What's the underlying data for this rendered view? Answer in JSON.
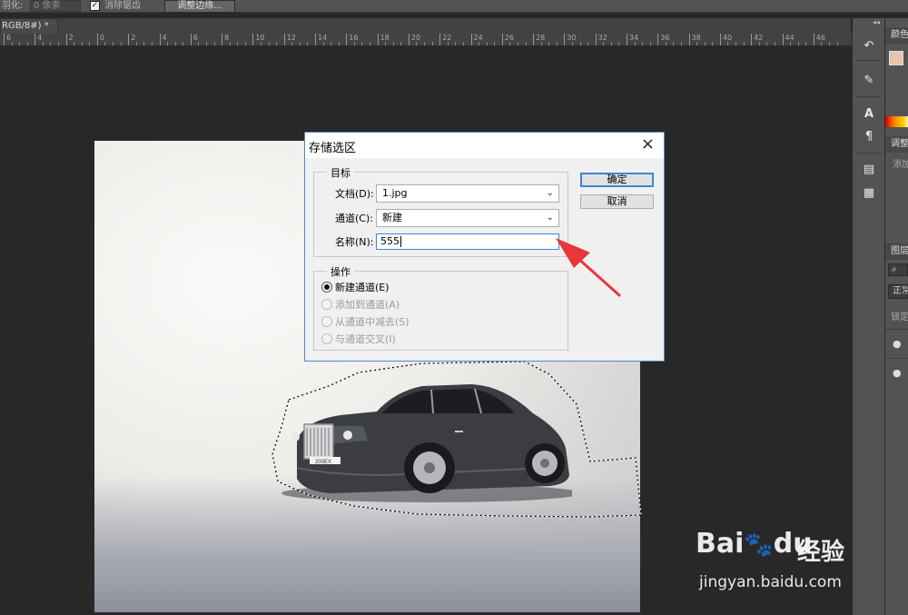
{
  "options_bar": {
    "feather_label": "羽化:",
    "feather_value": "0 像素",
    "antialias_checked": "✓",
    "antialias_label": "消除锯齿",
    "refine_button": "调整边缘..."
  },
  "document_tab": {
    "title": "RGB/8#) *",
    "close": "×"
  },
  "ruler": {
    "labels": [
      "6",
      "4",
      "2",
      "0",
      "2",
      "4",
      "6",
      "8",
      "10",
      "12",
      "14",
      "16",
      "18",
      "20",
      "22",
      "24",
      "26",
      "28",
      "30",
      "32",
      "34",
      "36",
      "38",
      "40",
      "42",
      "44",
      "46"
    ]
  },
  "tool_strip": {
    "collapse": "◂◂",
    "icons": [
      "history-icon",
      "brush-preset-icon",
      "character-icon",
      "paragraph-icon",
      "clone-source-icon",
      "notes-icon"
    ]
  },
  "right_panel": {
    "color_tab": "颜色",
    "adjust_tab": "调整",
    "adjust_hint": "添加",
    "layers_tab": "图层",
    "blend_mode": "正常",
    "lock_label": "锁定"
  },
  "dialog": {
    "title": "存储选区",
    "close": "×",
    "target_group": "目标",
    "document_label": "文档(D):",
    "document_value": "1.jpg",
    "channel_label": "通道(C):",
    "channel_value": "新建",
    "name_label": "名称(N):",
    "name_value": "555",
    "ok_button": "确定",
    "cancel_button": "取消",
    "operation_group": "操作",
    "options": [
      {
        "label": "新建通道(E)",
        "selected": true
      },
      {
        "label": "添加到通道(A)",
        "selected": false
      },
      {
        "label": "从通道中减去(S)",
        "selected": false
      },
      {
        "label": "与通道交叉(I)",
        "selected": false
      }
    ]
  },
  "car_plate": "200EX",
  "annotation_color": "#e8363a",
  "watermark": {
    "brand": "Bai",
    "brand2": "du",
    "product": "经验",
    "url": "jingyan.baidu.com"
  }
}
